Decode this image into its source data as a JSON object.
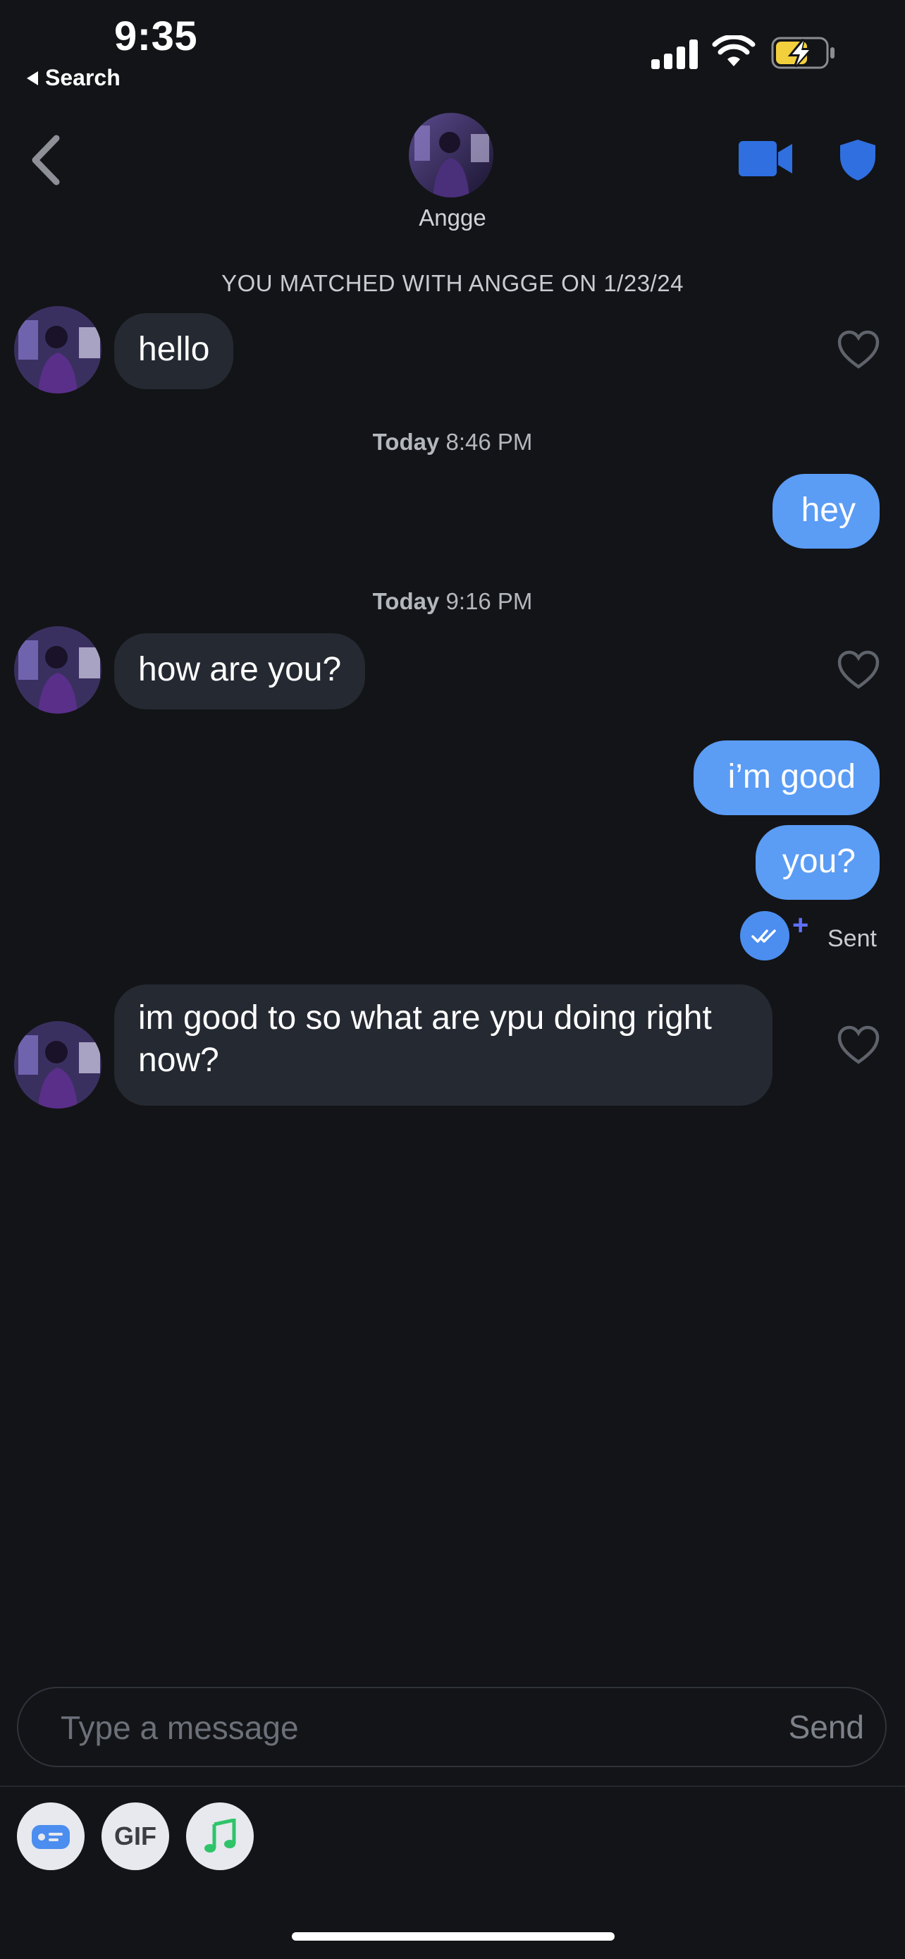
{
  "status_bar": {
    "time": "9:35",
    "back_app": "Search"
  },
  "header": {
    "contact_name": "Angge",
    "icons": [
      "chevron-left-icon",
      "video-camera-icon",
      "shield-icon"
    ]
  },
  "match_banner": "YOU MATCHED WITH ANGGE ON 1/23/24",
  "timestamps": [
    {
      "day": "Today",
      "time": "8:46 PM"
    },
    {
      "day": "Today",
      "time": "9:16 PM"
    }
  ],
  "messages": [
    {
      "from": "them",
      "text": "hello"
    },
    {
      "from": "me",
      "text": "hey"
    },
    {
      "from": "them",
      "text": "how are you?"
    },
    {
      "from": "me",
      "text": "i’m good"
    },
    {
      "from": "me",
      "text": "you?"
    },
    {
      "from": "them",
      "text": "im good to so what are ypu doing right now?"
    }
  ],
  "read_receipt": {
    "status": "Sent"
  },
  "composer": {
    "placeholder": "Type a message",
    "send_label": "Send"
  },
  "toolbar": {
    "gif_label": "GIF"
  },
  "colors": {
    "background": "#131417",
    "incoming_bubble": "#252931",
    "outgoing_bubble": "#5b9cf5",
    "accent_blue": "#2f6fe0"
  }
}
